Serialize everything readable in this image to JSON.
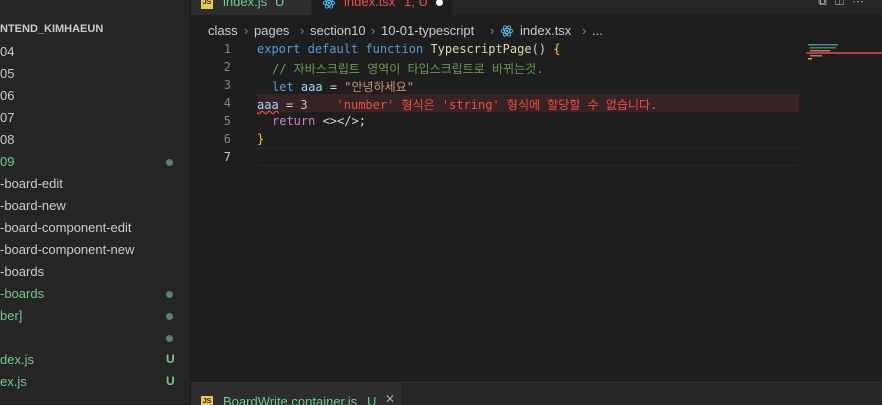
{
  "sidebar": {
    "root_label": "NTEND_KIMHAEUN",
    "items": [
      {
        "label": "04",
        "color": "#cccccc",
        "dot": false,
        "badge": ""
      },
      {
        "label": "05",
        "color": "#cccccc",
        "dot": false,
        "badge": ""
      },
      {
        "label": "06",
        "color": "#cccccc",
        "dot": false,
        "badge": ""
      },
      {
        "label": "07",
        "color": "#cccccc",
        "dot": false,
        "badge": ""
      },
      {
        "label": "08",
        "color": "#cccccc",
        "dot": false,
        "badge": ""
      },
      {
        "label": "09",
        "color": "#73c991",
        "dot": true,
        "badge": ""
      },
      {
        "label": "-board-edit",
        "color": "#cccccc",
        "dot": false,
        "badge": ""
      },
      {
        "label": "-board-new",
        "color": "#cccccc",
        "dot": false,
        "badge": ""
      },
      {
        "label": "-board-component-edit",
        "color": "#cccccc",
        "dot": false,
        "badge": ""
      },
      {
        "label": "-board-component-new",
        "color": "#cccccc",
        "dot": false,
        "badge": ""
      },
      {
        "label": "-boards",
        "color": "#cccccc",
        "dot": false,
        "badge": ""
      },
      {
        "label": "-boards",
        "color": "#73c991",
        "dot": true,
        "badge": ""
      },
      {
        "label": "ber]",
        "color": "#73c991",
        "dot": true,
        "badge": ""
      },
      {
        "label": "",
        "color": "#73c991",
        "dot": true,
        "badge": ""
      },
      {
        "label": "dex.js",
        "color": "#73c991",
        "dot": false,
        "badge": "U"
      },
      {
        "label": "ex.js",
        "color": "#73c991",
        "dot": false,
        "badge": "U"
      }
    ]
  },
  "tabs": [
    {
      "label": "index.js",
      "status": "U",
      "color": "#73c991",
      "active": false
    },
    {
      "label": "index.tsx",
      "status": "1, U",
      "color": "#f14c4c",
      "active": true
    }
  ],
  "breadcrumb": [
    "class",
    "pages",
    "section10",
    "10-01-typescript",
    "index.tsx",
    "..."
  ],
  "editor": {
    "line_numbers": [
      "1",
      "2",
      "3",
      "4",
      "5",
      "6",
      "7"
    ],
    "lines": {
      "l1": {
        "export": "export",
        "default": "default",
        "function": "function",
        "name": "TypescriptPage",
        "rest": "() ",
        "open": "{"
      },
      "l2": {
        "comment": "// 자바스크립트 영역이 타입스크립트로 바뀌는것."
      },
      "l3": {
        "let": "let",
        "var": "aaa",
        "eq": " = ",
        "str": "\"안녕하세요\""
      },
      "l4": {
        "var": "aaa",
        "eq": " = ",
        "num": "3",
        "error": "'number' 형식은 'string' 형식에 할당할 수 없습니다."
      },
      "l5": {
        "return": "return",
        "rest": " <></>;"
      },
      "l6": {
        "close": "}"
      }
    }
  },
  "bottom_panel": {
    "tab_label": "BoardWrite.container.js",
    "tab_status": "U"
  }
}
